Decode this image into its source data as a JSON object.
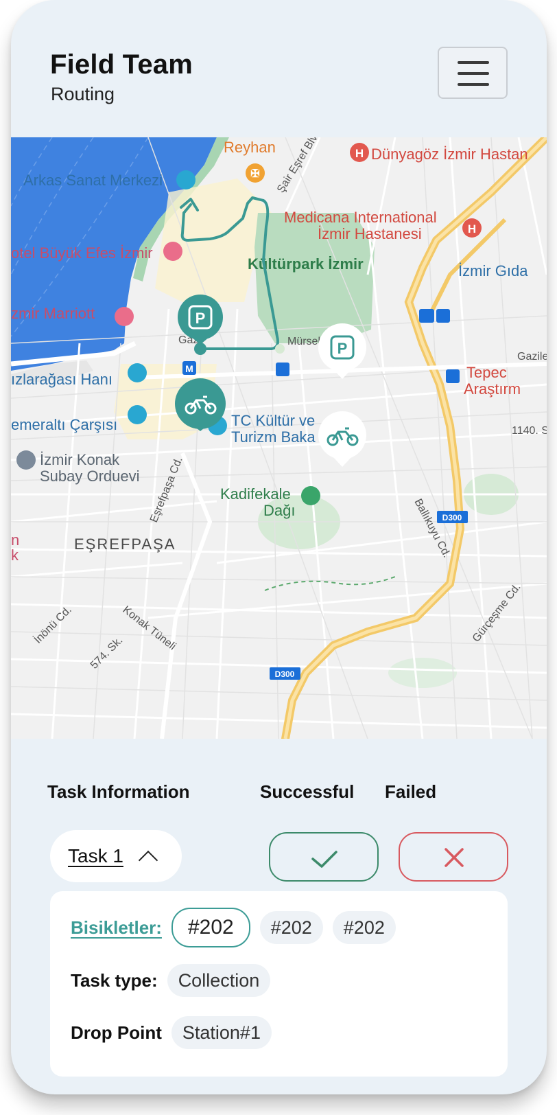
{
  "header": {
    "title": "Field Team",
    "subtitle": "Routing"
  },
  "map": {
    "labels": {
      "reyhan": "Reyhan",
      "sair_esref": "Şair Eşref Blv.",
      "dunyagoz": "Dünyagöz İzmir Hastan",
      "arkas": "Arkas Sanat Merkezi",
      "medicana1": "Medicana International",
      "medicana2": "İzmir Hastanesi",
      "buyuk_efes": "otel Büyük Efes İzmir",
      "kulturpark": "Kültürpark İzmir",
      "izmir_gida": "İzmir Gıda",
      "marriott": "zmir Marriott",
      "gazi": "Gazi",
      "bulv": "Bv",
      "mursel": "Mürsel",
      "gazile": "Gazile",
      "tepec": "Tepec",
      "arastirma": "Araştırm",
      "kizlaragasi": "ızlarağası Hanı",
      "kemeralti": "emeraltı Çarşısı",
      "tc_kultur1": "TC Kültür ve",
      "tc_kultur2": "Turizm Baka",
      "street_1140": "1140. S",
      "konak1": "İzmir Konak",
      "konak2": "Subay Orduevi",
      "esrefpasa_cd": "Eşrefpaşa Cd.",
      "kadifekale1": "Kadifekale",
      "kadifekale2": "Dağı",
      "ballikuyu": "Ballıkuyu Cd.",
      "d300": "D300",
      "esrefpasa": "EŞREFPAŞA",
      "edge_n": "n",
      "edge_k": "k",
      "inonu": "İnönü Cd.",
      "konak_tuneli": "Konak Tüneli",
      "sk574": "574. Sk.",
      "gurcesme": "Gürçeşme Cd.",
      "metro_m": "M",
      "parking_p": "P"
    }
  },
  "task": {
    "info_label": "Task Information",
    "successful_label": "Successful",
    "failed_label": "Failed",
    "selected_task": "Task 1",
    "bikes_label": "Bisikletler:",
    "bikes": [
      "#202",
      "#202",
      "#202"
    ],
    "task_type_label": "Task type:",
    "task_type": "Collection",
    "drop_point_label": "Drop Point",
    "drop_point": "Station#1"
  },
  "colors": {
    "accent": "#3c9c96",
    "success": "#3c8a6a",
    "fail": "#d8595f",
    "route": "#3a9993",
    "background": "#eaf1f7"
  },
  "icons": [
    "menu-icon",
    "parking-icon",
    "bicycle-icon",
    "check-icon",
    "close-icon",
    "chevron-up-icon"
  ]
}
